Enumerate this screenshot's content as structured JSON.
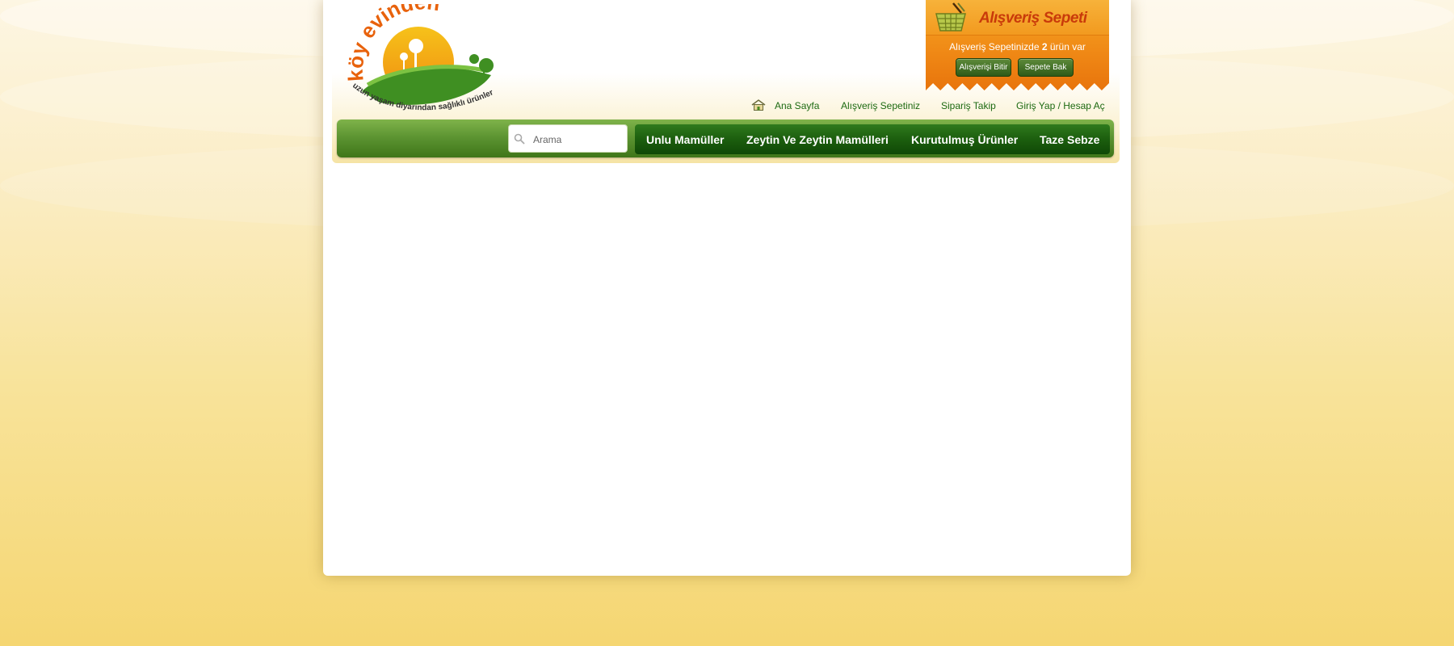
{
  "brand": {
    "name": "köy evinden",
    "tagline": "uzun yaşam diyarından sağlıklı ürünler"
  },
  "cart": {
    "title": "Alışveriş Sepeti",
    "info_prefix": "Alışveriş Sepetinizde ",
    "count": "2",
    "info_suffix": " ürün var",
    "checkout_label": "Alışverişi Bitir",
    "view_label": "Sepete Bak"
  },
  "toplinks": {
    "home": "Ana Sayfa",
    "cart": "Alışveriş Sepetiniz",
    "order_tracking": "Sipariş Takip",
    "login": "Giriş Yap / Hesap Aç"
  },
  "search": {
    "placeholder": "Arama"
  },
  "menu": [
    {
      "label": "Unlu Mamüller"
    },
    {
      "label": "Zeytin Ve Zeytin Mamülleri"
    },
    {
      "label": "Kurutulmuş Ürünler"
    },
    {
      "label": "Taze Sebze"
    }
  ],
  "colors": {
    "cart_orange": "#f29a1f",
    "nav_green": "#5a9230",
    "menu_dark_green": "#1c5e0e",
    "link_green": "#1d6a12"
  }
}
